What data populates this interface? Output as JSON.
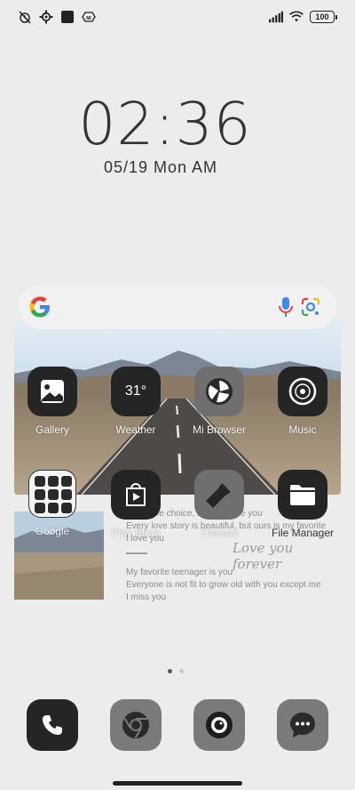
{
  "status_bar": {
    "left_icons": [
      "alarm-off-icon",
      "settings-gear-icon",
      "square-icon",
      "mi-icon"
    ],
    "right_icons": [
      "signal-icon",
      "wifi-icon"
    ],
    "battery_level": "100"
  },
  "lockclock": {
    "time": "02:36",
    "date": "05/19 Mon AM"
  },
  "search_bar": {
    "icons": [
      "google-logo-icon",
      "microphone-icon",
      "lens-icon"
    ]
  },
  "apps_row1": [
    {
      "label": "Gallery",
      "icon": "gallery-icon"
    },
    {
      "label": "Weather",
      "icon": "weather-icon",
      "temp": "31°"
    },
    {
      "label": "Mi Browser",
      "icon": "browser-icon"
    },
    {
      "label": "Music",
      "icon": "music-icon"
    }
  ],
  "apps_row2": [
    {
      "label": "Google",
      "icon": "google-folder-icon"
    },
    {
      "label": "Play Store",
      "icon": "play-store-icon"
    },
    {
      "label": "Themes",
      "icon": "themes-brush-icon"
    },
    {
      "label": "File Manager",
      "icon": "folder-icon"
    }
  ],
  "quote_widget": {
    "line1": "Life is the choice, I will choose you",
    "line2": "Every love story is beautiful, but ours is my favorite",
    "line3": "I love you",
    "script": "Love you forever",
    "line4": "My favorite teenager is you",
    "line5": "Everyone is not fit to grow old with you except me",
    "line6": "I miss you"
  },
  "page_indicator": {
    "pages": 2,
    "current": 1
  },
  "dock": [
    "phone-icon",
    "chrome-icon",
    "camera-icon",
    "messages-icon"
  ]
}
